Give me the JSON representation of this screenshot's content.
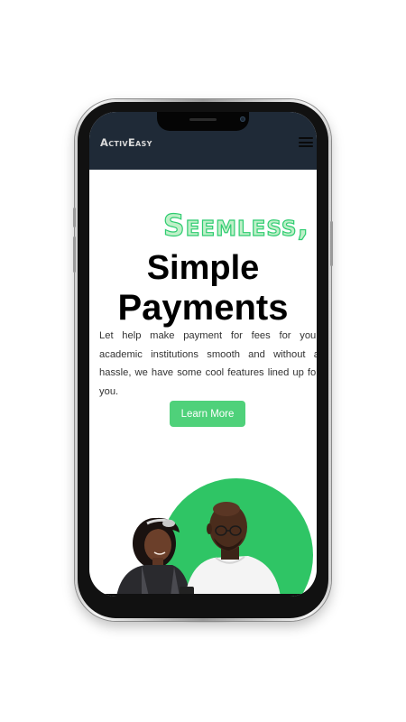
{
  "navbar": {
    "brand": "ActivEasy",
    "menu_icon": "hamburger-menu-icon"
  },
  "hero": {
    "title_accent": "Seemless,",
    "title_line2": "Simple",
    "title_line3": "Payments",
    "description": "Let help make payment for fees for your academic institutions smooth and without a hassle, we have some cool features lined up for you.",
    "cta_label": "Learn More"
  },
  "colors": {
    "navbar_bg": "#1f2a37",
    "accent_green": "#2ecc71",
    "button_green": "#4fd17a",
    "circle_green": "#2fc565"
  }
}
